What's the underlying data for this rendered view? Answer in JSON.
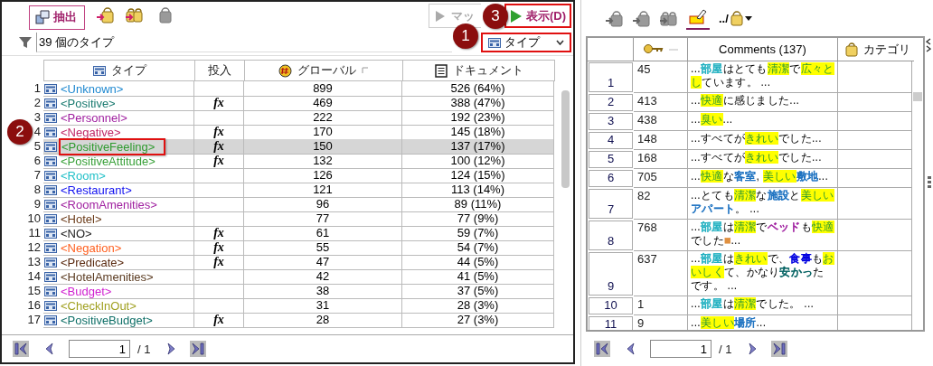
{
  "left_panel": {
    "toolbar": {
      "extract_tab": {
        "label": "抽出",
        "selected": true
      },
      "map_button": {
        "label": "マッ"
      },
      "show_button": {
        "label": "表示(D)"
      }
    },
    "filter": {
      "value": "39 個のタイプ"
    },
    "view_dropdown": {
      "value": "タイプ"
    },
    "table": {
      "columns": [
        "タイプ",
        "投入",
        "グローバル",
        "ドキュメント"
      ],
      "rows": [
        {
          "number": "1",
          "type": "<Unknown>",
          "color": "#1e88d0",
          "input": "",
          "global": "899",
          "documents": "526 (64%)",
          "selected": false
        },
        {
          "number": "2",
          "type": "<Positive>",
          "color": "#1a7a70",
          "input": "fx",
          "global": "469",
          "documents": "388 (47%)",
          "selected": false
        },
        {
          "number": "3",
          "type": "<Personnel>",
          "color": "#a020a0",
          "input": "",
          "global": "222",
          "documents": "192 (23%)",
          "selected": false
        },
        {
          "number": "4",
          "type": "<Negative>",
          "color": "#c02868",
          "input": "fx",
          "global": "170",
          "documents": "145 (18%)",
          "selected": false
        },
        {
          "number": "5",
          "type": "<PositiveFeeling>",
          "color": "#2e9a2e",
          "input": "fx",
          "global": "150",
          "documents": "137 (17%)",
          "selected": true
        },
        {
          "number": "6",
          "type": "<PositiveAttitude>",
          "color": "#38a038",
          "input": "fx",
          "global": "132",
          "documents": "100 (12%)",
          "selected": false
        },
        {
          "number": "7",
          "type": "<Room>",
          "color": "#20c0c8",
          "input": "",
          "global": "126",
          "documents": "124 (15%)",
          "selected": false
        },
        {
          "number": "8",
          "type": "<Restaurant>",
          "color": "#1010f0",
          "input": "",
          "global": "121",
          "documents": "113 (14%)",
          "selected": false
        },
        {
          "number": "9",
          "type": "<RoomAmenities>",
          "color": "#a020a0",
          "input": "",
          "global": "96",
          "documents": "89 (11%)",
          "selected": false
        },
        {
          "number": "10",
          "type": "<Hotel>",
          "color": "#6a3a18",
          "input": "",
          "global": "77",
          "documents": "77 (9%)",
          "selected": false
        },
        {
          "number": "11",
          "type": "<NO>",
          "color": "#202020",
          "input": "fx",
          "global": "61",
          "documents": "59 (7%)",
          "selected": false
        },
        {
          "number": "12",
          "type": "<Negation>",
          "color": "#ff6020",
          "input": "fx",
          "global": "55",
          "documents": "54 (7%)",
          "selected": false
        },
        {
          "number": "13",
          "type": "<Predicate>",
          "color": "#5a2a10",
          "input": "fx",
          "global": "47",
          "documents": "44 (5%)",
          "selected": false
        },
        {
          "number": "14",
          "type": "<HotelAmenities>",
          "color": "#5a3a20",
          "input": "",
          "global": "42",
          "documents": "41 (5%)",
          "selected": false
        },
        {
          "number": "15",
          "type": "<Budget>",
          "color": "#d020d0",
          "input": "",
          "global": "38",
          "documents": "37 (5%)",
          "selected": false
        },
        {
          "number": "16",
          "type": "<CheckInOut>",
          "color": "#a0a020",
          "input": "",
          "global": "31",
          "documents": "28 (3%)",
          "selected": false
        },
        {
          "number": "17",
          "type": "<PositiveBudget>",
          "color": "#107068",
          "input": "fx",
          "global": "28",
          "documents": "27 (3%)",
          "selected": false
        }
      ]
    },
    "pager": {
      "page": "1",
      "total": "/ 1"
    }
  },
  "right_panel": {
    "path_label": "../",
    "table": {
      "columns": [
        "Comments (137)",
        "カテゴリ"
      ],
      "rows": [
        {
          "number": "1",
          "id": "45",
          "segments": [
            {
              "text": "...",
              "highlight": false
            },
            {
              "text": "部屋",
              "color": "#20b0c0",
              "highlight": false
            },
            {
              "text": "はとても",
              "highlight": false
            },
            {
              "text": "清潔",
              "highlight": true
            },
            {
              "text": "で",
              "highlight": false
            },
            {
              "text": "広々とし",
              "highlight": true
            },
            {
              "text": "ています。 ...",
              "highlight": false
            }
          ]
        },
        {
          "number": "2",
          "id": "413",
          "segments": [
            {
              "text": "...",
              "highlight": false
            },
            {
              "text": "快適",
              "highlight": true
            },
            {
              "text": "に感じました...",
              "highlight": false
            }
          ]
        },
        {
          "number": "3",
          "id": "438",
          "segments": [
            {
              "text": "...",
              "highlight": false
            },
            {
              "text": "臭い",
              "highlight": true
            },
            {
              "text": "...",
              "highlight": false
            }
          ]
        },
        {
          "number": "4",
          "id": "148",
          "segments": [
            {
              "text": "...すべてが",
              "highlight": false
            },
            {
              "text": "きれい",
              "highlight": true
            },
            {
              "text": "でした...",
              "highlight": false
            }
          ]
        },
        {
          "number": "5",
          "id": "168",
          "segments": [
            {
              "text": "...すべてが",
              "highlight": false
            },
            {
              "text": "きれい",
              "highlight": true
            },
            {
              "text": "でした...",
              "highlight": false
            }
          ]
        },
        {
          "number": "6",
          "id": "705",
          "segments": [
            {
              "text": "...",
              "highlight": false
            },
            {
              "text": "快適",
              "highlight": true
            },
            {
              "text": "な",
              "highlight": false
            },
            {
              "text": "客室",
              "color": "#1a70c0",
              "highlight": false
            },
            {
              "text": ", ",
              "highlight": false
            },
            {
              "text": "美しい",
              "highlight": true
            },
            {
              "text": "敷地",
              "color": "#1a70c0",
              "highlight": false
            },
            {
              "text": "...",
              "highlight": false
            }
          ]
        },
        {
          "number": "7",
          "id": "82",
          "segments": [
            {
              "text": "...とても",
              "highlight": false
            },
            {
              "text": "清潔",
              "highlight": true
            },
            {
              "text": "な",
              "highlight": false
            },
            {
              "text": "施設",
              "color": "#1a70c0",
              "highlight": false
            },
            {
              "text": "と",
              "highlight": false
            },
            {
              "text": "美しい",
              "highlight": true
            },
            {
              "text": "アパート",
              "color": "#1a70c0",
              "highlight": false
            },
            {
              "text": "。 ...",
              "highlight": false
            }
          ]
        },
        {
          "number": "8",
          "id": "768",
          "segments": [
            {
              "text": "...",
              "highlight": false
            },
            {
              "text": "部屋",
              "color": "#20b0c0",
              "highlight": false
            },
            {
              "text": "は",
              "highlight": false
            },
            {
              "text": "清潔",
              "highlight": true
            },
            {
              "text": "で",
              "highlight": false
            },
            {
              "text": "ベッド",
              "color": "#a020a0",
              "highlight": false
            },
            {
              "text": "も",
              "highlight": false
            },
            {
              "text": "快適",
              "highlight": true
            },
            {
              "text": "でした",
              "highlight": false
            },
            {
              "text": "■",
              "color": "#e09040",
              "highlight": false
            },
            {
              "text": "...",
              "highlight": false
            }
          ]
        },
        {
          "number": "9",
          "id": "637",
          "segments": [
            {
              "text": "...",
              "highlight": false
            },
            {
              "text": "部屋",
              "color": "#20b0c0",
              "highlight": false
            },
            {
              "text": "は",
              "highlight": false
            },
            {
              "text": "きれい",
              "highlight": true
            },
            {
              "text": "で、",
              "highlight": false
            },
            {
              "text": "食事",
              "color": "#0000e0",
              "highlight": false
            },
            {
              "text": "も",
              "highlight": false
            },
            {
              "text": "おいしく",
              "highlight": true
            },
            {
              "text": "て、かなり",
              "highlight": false
            },
            {
              "text": "安かっ",
              "color": "#006060",
              "highlight": false
            },
            {
              "text": "たです。 ...",
              "highlight": false
            }
          ]
        },
        {
          "number": "10",
          "id": "1",
          "segments": [
            {
              "text": "...",
              "highlight": false
            },
            {
              "text": "部屋",
              "color": "#20b0c0",
              "highlight": false
            },
            {
              "text": "は",
              "highlight": false
            },
            {
              "text": "清潔",
              "highlight": true
            },
            {
              "text": "でした。 ...",
              "highlight": false
            }
          ]
        },
        {
          "number": "11",
          "id": "9",
          "segments": [
            {
              "text": "...",
              "highlight": false
            },
            {
              "text": "美しい",
              "highlight": true
            },
            {
              "text": "場所",
              "color": "#1a70c0",
              "highlight": false
            },
            {
              "text": "...",
              "highlight": false
            }
          ]
        }
      ]
    },
    "pager": {
      "page": "1",
      "total": "/ 1"
    }
  },
  "callouts": [
    {
      "number": "1"
    },
    {
      "number": "2"
    },
    {
      "number": "3"
    }
  ]
}
